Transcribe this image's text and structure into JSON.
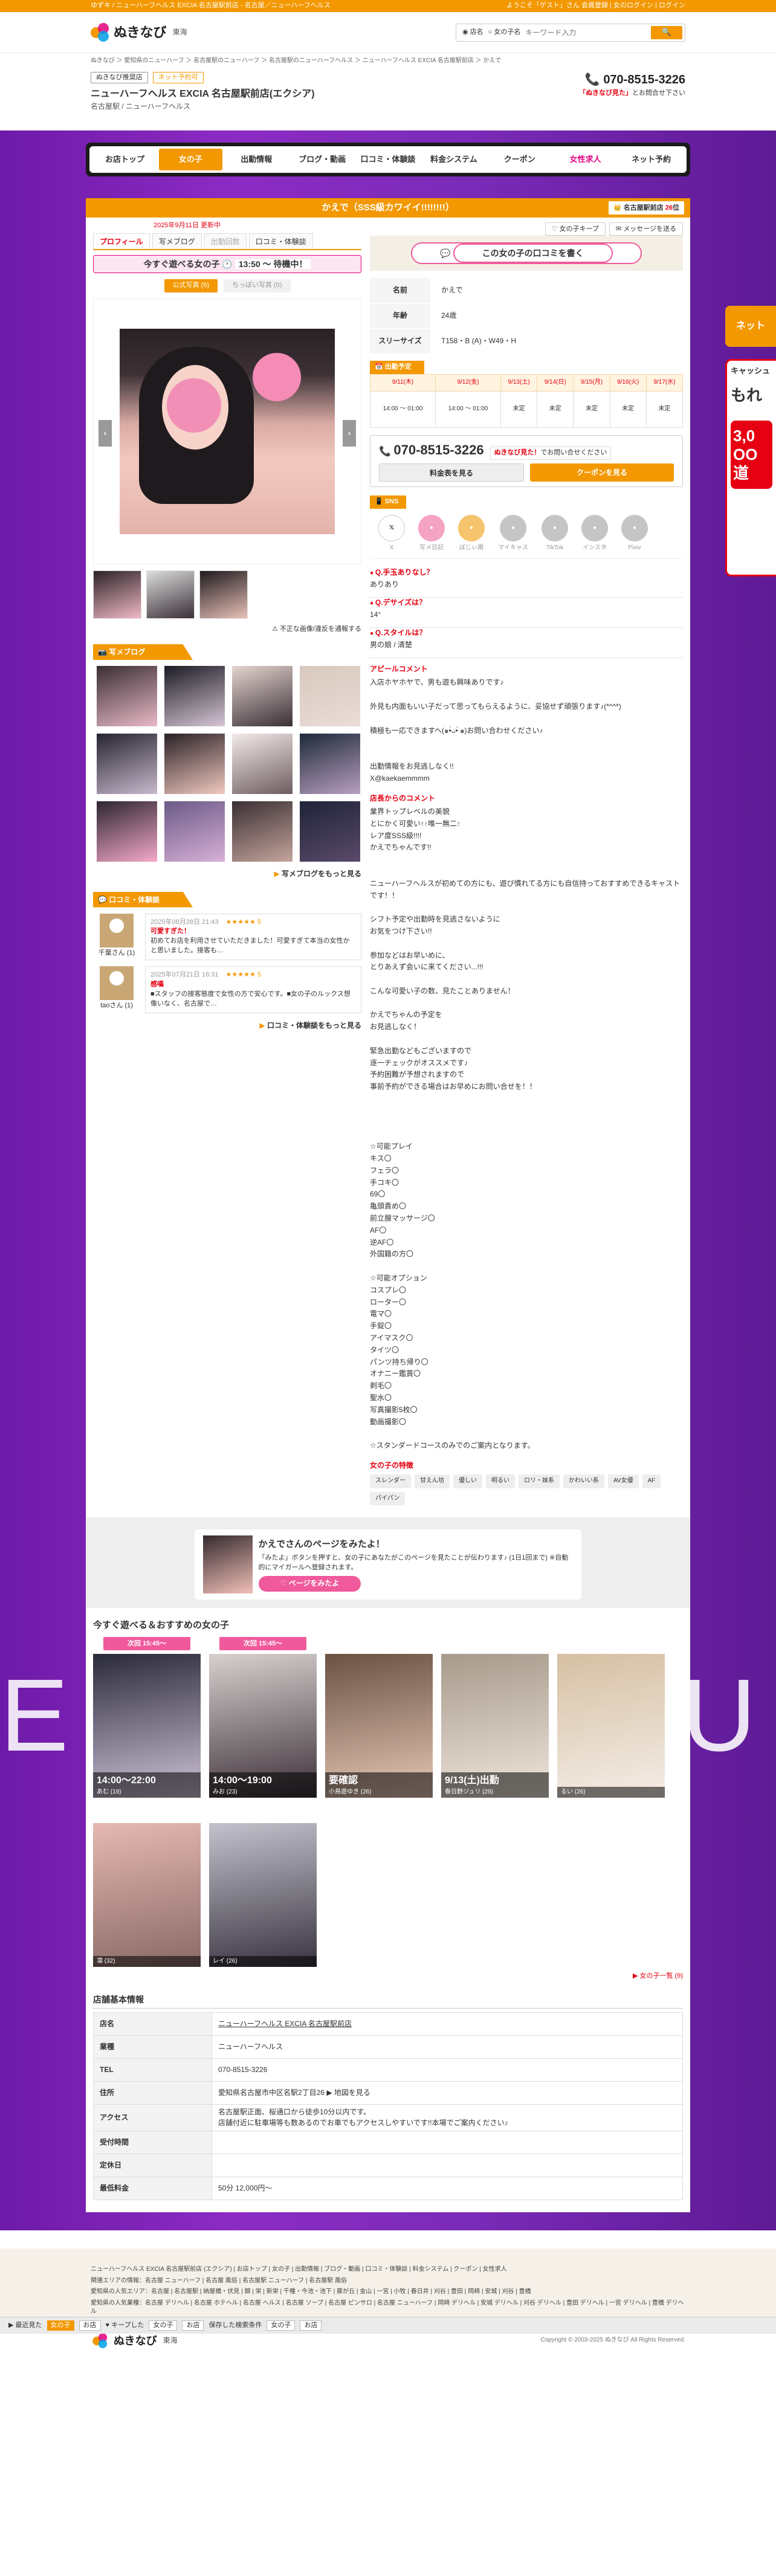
{
  "topbar": {
    "left": "ゆずキ / ニューハーフヘルス EXCIA 名古屋駅前店 - 名古屋／ニューハーフヘルス",
    "right": "ようこそ「ゲスト」さん 会員登録 | 女のログイン | ログイン"
  },
  "logo": {
    "text": "ぬきなび",
    "region": "東海"
  },
  "search": {
    "opt1": "店名",
    "opt2": "女の子名",
    "placeholder": "キーワード入力",
    "btn": "🔍"
  },
  "breadcrumb": "ぬきなび ＞ 愛知県のニューハーフ ＞ 名古屋駅のニューハーフ ＞ 名古屋駅のニューハーフヘルス ＞ ニューハーフヘルス EXCIA 名古屋駅前店 ＞ かえで",
  "shop": {
    "tag1": "ぬきなび推奨店",
    "tag2": "ネット予約可",
    "name": "ニューハーフヘルス EXCIA 名古屋駅前店(エクシア)",
    "sub": "名古屋駅 / ニューハーフヘルス",
    "phone": "070-8515-3226",
    "phone_note_em": "「ぬきなび見た」",
    "phone_note": "とお問合せ下さい"
  },
  "nav": [
    "お店トップ",
    "女の子",
    "出勤情報",
    "ブログ・動画",
    "口コミ・体験談",
    "料金システム",
    "クーポン",
    "女性求人",
    "ネット予約"
  ],
  "side": {
    "btn": "ネット",
    "b1": "キャッシュ",
    "b2": "もれ",
    "b3": "3,0 OO 道"
  },
  "catch": "かえで（SSS級カワイイ!!!!!!!!）",
  "rank": {
    "area": "名古屋駅前店",
    "num": "26",
    "unit": "位"
  },
  "date": "2025年9月11日 更新中",
  "tabs": {
    "profile": "プロフィール",
    "blog": "写メブログ",
    "reserve": "出勤回数",
    "review": "口コミ・体験談",
    "fav": "♡ 女の子キープ",
    "msg": "✉ メッセージを送る"
  },
  "today": {
    "label": "今すぐ遊べる女の子",
    "time": "13:50 〜 待機中！"
  },
  "phototabs": {
    "on": "公式写真 (5)",
    "off": "ちっぽい写真 (0)"
  },
  "photonote": "不正な画像/違反を通報する",
  "blog": {
    "head": "写メブログ",
    "more": "写メブログをもっと見る"
  },
  "reviews": {
    "head": "口コミ・体験談",
    "more": "口コミ・体験談をもっと見る",
    "items": [
      {
        "user": "千葉さん (1)",
        "meta": "2025年08月28日 21:43",
        "stars": "★★★★★ 5",
        "title": "可愛すぎた！",
        "body": "初めてお店を利用させていただきました！可愛すぎて本当の女性かと思いました。接客も…"
      },
      {
        "user": "taoさん (1)",
        "meta": "2025年07月21日 16:31",
        "stars": "★★★★★ 5",
        "title": "感嘆",
        "body": "■スタッフの接客態度で女性の方で安心です。■女の子のルックス想像いなく、名古屋で…"
      }
    ]
  },
  "cta": "この女の子の口コミを書く",
  "profile": [
    {
      "k": "名前",
      "v": "かえで"
    },
    {
      "k": "年齢",
      "v": "24歳"
    },
    {
      "k": "スリーサイズ",
      "v": "T158・B (A)・W49・H"
    }
  ],
  "schedule": {
    "head": "出勤予定",
    "days": [
      "9/11(木)",
      "9/12(金)",
      "9/13(土)",
      "9/14(日)",
      "9/15(月)",
      "9/16(火)",
      "9/17(水)"
    ],
    "cells": [
      "14:00 〜 01:00",
      "14:00 〜 01:00",
      "未定",
      "未定",
      "未定",
      "未定",
      "未定"
    ]
  },
  "contact": {
    "tel": "070-8515-3226",
    "extra_em": "ぬきなび見た！",
    "extra": "でお問い合せください",
    "b1": "料金表を見る",
    "b2": "クーポンを見る"
  },
  "sns": {
    "head": "SNS",
    "items": [
      "X",
      "写メ日記",
      "ぽじぃ掲",
      "マイキャス",
      "TikTok",
      "インスタ",
      "Pixiv"
    ]
  },
  "qa": [
    {
      "q": "Q.手玉ありなし？",
      "a": "ありあり"
    },
    {
      "q": "Q.デサイズは？",
      "a": "14°"
    },
    {
      "q": "Q.スタイルは？",
      "a": "男の娘 / 清楚"
    }
  ],
  "appeal": {
    "head": "アピールコメント",
    "body": "入店ホヤホヤで、男も遊も興味ありです♪\n\n外見も内面もいい子だって思ってもらえるように、妥協せず頑張ります♪(*^^*)\n\n積極も一応できますヘ(๑•̀ᴗ•́ ๑)お問い合わせください♪\n\n\n出勤情報をお見逃しなく!!\nX@kaekaemmmm"
  },
  "staff": {
    "head": "店長からのコメント",
    "body": "業界トップレベルの美貌\nとにかく可愛い↑↑唯一無二↑\nレア度SSS級!!!!\nかえでちゃんです!!\n\n\nニューハーフヘルスが初めての方にも、遊び慣れてる方にも自信持っておすすめできるキャストです！！\n\nシフト予定や出勤時を見逃さないように\nお気をつけ下さい!!\n\n参加などはお早いめに、\nとりあえず会いに来てください...!!!\n\nこんな可愛い子の数、見たことありません！\n\nかえでちゃんの予定を\nお見逃しなく！\n\n緊急出勤などもございますので\n逐一チェックがオススメです♪\n予約困難が予想されますので\n事前予約ができる場合はお早めにお問い合せを！！\n\n\n\n\n☆可能プレイ\nキス〇\nフェラ〇\n手コキ〇\n69〇\n亀頭責め〇\n前立腺マッサージ〇\nAF〇\n逆AF〇\n外国籍の方〇\n\n☆可能オプション\nコスプレ〇\nローター〇\n電マ〇\n手錠〇\nアイマスク〇\nタイツ〇\nパンツ持ち帰り〇\nオナニー鑑賞〇\n剃毛〇\n聖水〇\n写真撮影5枚〇\n動画撮影〇\n\n☆スタンダードコースのみでのご案内となります。"
  },
  "features": {
    "head": "女の子の特徴",
    "items": [
      "スレンダー",
      "甘えん坊",
      "優しい",
      "明るい",
      "ロリ・妹系",
      "かわいい系",
      "AV女優",
      "AF",
      "パイパン"
    ]
  },
  "wantsee": {
    "title": "かえでさんのページをみたよ！",
    "body": "「みたよ」ボタンを押すと、女の子にあなたがこのページを見たことが伝わります♪ (1日1回まで) ※自動的にマイガールへ登録されます。",
    "btn": "♡ ページをみたよ"
  },
  "recommend": {
    "head": "今すぐ遊べる＆おすすめの女の子",
    "more": "▶ 女の子一覧 (9)",
    "girls": [
      {
        "badge": "次回 15:45〜",
        "time": "14:00〜22:00",
        "name": "あむ (19)",
        "c1": "#2a2a3a",
        "c2": "#cfc3d9"
      },
      {
        "badge": "次回 15:45〜",
        "time": "14:00〜19:00",
        "name": "みお (23)",
        "c1": "#d8d0cf",
        "c2": "#3b3038"
      },
      {
        "badge": "",
        "time": "要確認",
        "name": "小鳥遊ゆき (26)",
        "c1": "#6a5244",
        "c2": "#e7c8b6"
      },
      {
        "badge": "",
        "time": "9/13(土)出勤",
        "name": "春日野ジュリ (29)",
        "c1": "#a79a8c",
        "c2": "#efe6dc"
      },
      {
        "badge": "",
        "time": "",
        "name": "るい (26)",
        "c1": "#d6c0a3",
        "c2": "#f4ede7"
      },
      {
        "badge": "",
        "time": "",
        "name": "凛 (32)",
        "c1": "#e6b8b2",
        "c2": "#8a6a66"
      },
      {
        "badge": "",
        "time": "",
        "name": "レイ (26)",
        "c1": "#c2c2cc",
        "c2": "#3a3440"
      }
    ]
  },
  "basic": {
    "head": "店舗基本情報",
    "rows": [
      {
        "k": "店名",
        "v": "ニューハーフヘルス EXCIA 名古屋駅前店"
      },
      {
        "k": "業種",
        "v": "ニューハーフヘルス"
      },
      {
        "k": "TEL",
        "v": "070-8515-3226"
      },
      {
        "k": "住所",
        "v": "愛知県名古屋市中区名駅2丁目26 ▶ 地図を見る"
      },
      {
        "k": "アクセス",
        "v": "名古屋駅正面、桜通口から徒歩10分以内です。\n店舗付近に駐車場等も数あるのでお車でもアクセスしやすいです!!本場でご案内ください♪"
      },
      {
        "k": "受付時間",
        "v": ""
      },
      {
        "k": "定休日",
        "v": ""
      },
      {
        "k": "最低料金",
        "v": "50分 12,000円〜"
      }
    ]
  },
  "floatbar": {
    "label": "▶ 最近見た",
    "on": "女の子",
    "t1": "お店",
    "label2": "♥ キープした",
    "t2": "女の子",
    "t3": "お店",
    "label3": "保存した検索条件",
    "t4": "女の子",
    "t5": "お店"
  },
  "footer": {
    "l1": "ニューハーフヘルス EXCIA 名古屋駅前店 (エクシア) | お店トップ | 女の子 | 出勤情報 | ブログ・動画 | 口コミ・体験談 | 料金システム | クーポン | 女性求人",
    "l2": "関連エリアの情報：名古屋 ニューハーフ | 名古屋 風俗 | 名古屋駅 ニューハーフ | 名古屋駅 風俗",
    "l3": "愛知県の人気エリア：名古屋 | 名古屋駅 | 納屋橋・伏見 | 錦 | 栄 | 新栄 | 千種・今池・池下 | 藤が丘 | 金山 | 一宮 | 小牧 | 春日井 | 刈谷 | 豊田 | 岡崎 | 安城 | 刈谷 | 豊橋",
    "l4": "愛知県の人気業種：名古屋 デリヘル | 名古屋 ホテヘル | 名古屋 ヘルス | 名古屋 ソープ | 名古屋 ピンサロ | 名古屋 ニューハーフ | 岡崎 デリヘル | 安城 デリヘル | 刈谷 デリヘル | 豊田 デリヘル | 一宮 デリヘル | 豊橋 デリヘル",
    "copy": "Copyright © 2003-2025 ぬきなび All Rights Reserved."
  }
}
